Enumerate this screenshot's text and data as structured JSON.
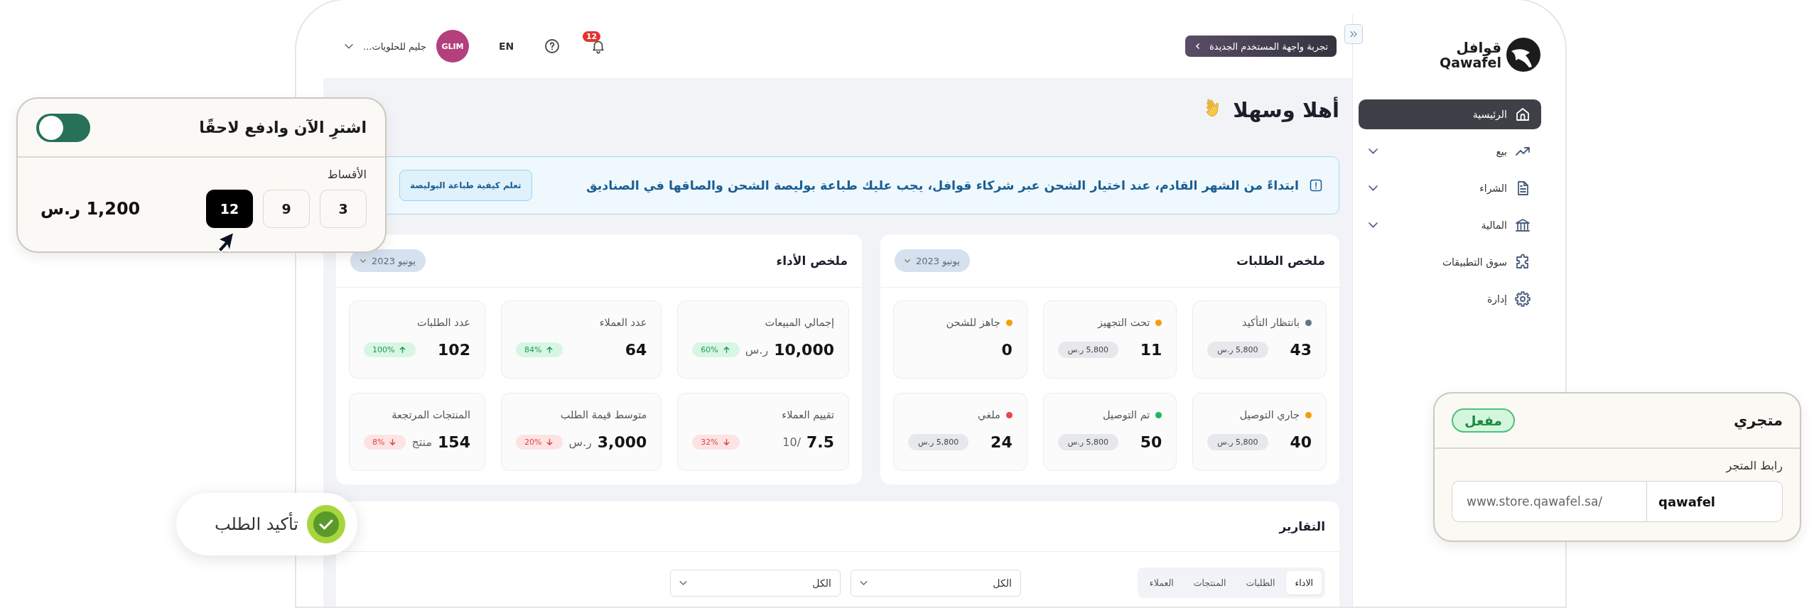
{
  "sidebar": {
    "logo": {
      "arabic": "قوافل",
      "latin": "Qawafel"
    },
    "items": [
      {
        "label": "الرئيسية",
        "kind": "link",
        "selected": true
      },
      {
        "label": "بيع",
        "kind": "group",
        "selected": false
      },
      {
        "label": "الشراء",
        "kind": "group",
        "selected": false
      },
      {
        "label": "المالية",
        "kind": "group",
        "selected": false
      },
      {
        "label": "سوق التطبيقات",
        "kind": "link",
        "selected": false
      },
      {
        "label": "إدارة",
        "kind": "link",
        "selected": false
      }
    ]
  },
  "header": {
    "new_ui_button": "تجربة واجهة المستخدم الجديدة",
    "notification_count": "12",
    "language": "EN",
    "avatar": "GLIM",
    "store_name": "جليم للحلويات..."
  },
  "welcome": "أهلا وسهلا",
  "notice": {
    "text": "ابتداءً من الشهر القادم، عند اختيار الشحن عبر شركاء قوافل، يجب عليك طباعة بوليصة الشحن والصاقها في الصناديق",
    "button": "تعلم كيفية طباعة البوليصة"
  },
  "orders_summary": {
    "title": "ملخص الطلبات",
    "period": "يونيو 2023",
    "cards": [
      {
        "label": "بانتظار التأكيد",
        "color": "#64748b",
        "count": "43",
        "amount": "5,800 ر.س"
      },
      {
        "label": "تحت التجهيز",
        "color": "#f59e0b",
        "count": "11",
        "amount": "5,800 ر.س"
      },
      {
        "label": "جاهز للشحن",
        "color": "#f59e0b",
        "count": "0"
      },
      {
        "label": "جاري التوصيل",
        "color": "#f59e0b",
        "count": "40",
        "amount": "5,800 ر.س"
      },
      {
        "label": "تم التوصيل",
        "color": "#22b55e",
        "count": "50",
        "amount": "5,800 ر.س"
      },
      {
        "label": "ملغي",
        "color": "#e5484d",
        "count": "24",
        "amount": "5,800 ر.س"
      }
    ]
  },
  "performance_summary": {
    "title": "ملخص الأداء",
    "period": "يونيو 2023",
    "cards": [
      {
        "label": "إجمالي المبيعات",
        "value": "10,000",
        "unit": "ر.س",
        "change": "60%",
        "kind": "up"
      },
      {
        "label": "عدد العملاء",
        "value": "64",
        "change": "84%",
        "kind": "up"
      },
      {
        "label": "عدد الطلبات",
        "value": "102",
        "change": "100%",
        "kind": "up"
      },
      {
        "label": "تقييم العملاء",
        "value": "7.5",
        "unit": "/10",
        "change": "32%",
        "kind": "down"
      },
      {
        "label": "متوسط قيمة الطلب",
        "value": "3,000",
        "unit": "ر.س",
        "change": "20%",
        "kind": "down"
      },
      {
        "label": "المنتجات المرتجعة",
        "value": "154",
        "unit": "منتج",
        "change": "8%",
        "kind": "down"
      }
    ]
  },
  "reports": {
    "title": "التقارير",
    "tabs": [
      {
        "label": "الاداء",
        "selected": true
      },
      {
        "label": "الطلبات",
        "selected": false
      },
      {
        "label": "المنتجات",
        "selected": false
      },
      {
        "label": "العملاء",
        "selected": false
      }
    ],
    "filters": [
      "الكل",
      "الكل"
    ]
  },
  "bnpl_card": {
    "title": "اشترِ الآن وادفع لاحقًا",
    "on": true,
    "installments_label": "الأقساط",
    "options": [
      {
        "label": "3",
        "selected": false
      },
      {
        "label": "9",
        "selected": false
      },
      {
        "label": "12",
        "selected": true
      }
    ],
    "amount": "1,200 ر.س"
  },
  "order_confirmation": {
    "label": "تأكيد الطلب"
  },
  "store_card": {
    "title": "متجري",
    "status": "مفعل",
    "link_label": "رابط المتجر",
    "url_prefix": "www.store.qawafel.sa/",
    "slug": "qawafel"
  }
}
